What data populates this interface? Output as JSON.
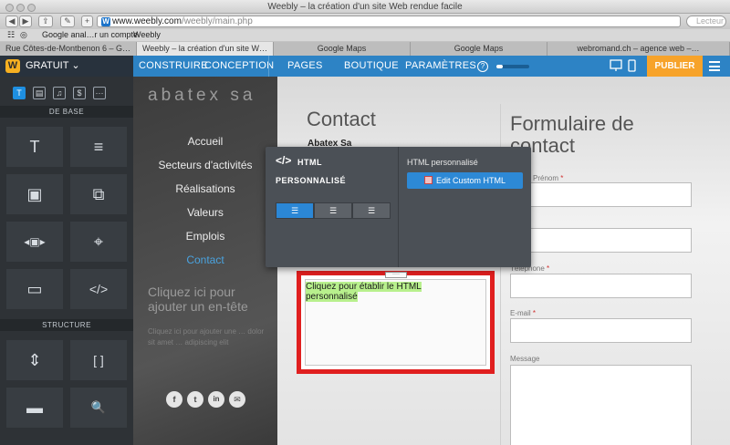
{
  "browser": {
    "window_title": "Weebly – la création d'un site Web rendue facile",
    "url_domain": "www.weebly.com",
    "url_path": "/weebly/main.php",
    "search_placeholder": "Lecteur",
    "bookmarks": [
      "Google anal…r un compte",
      "Weebly"
    ],
    "tabs": [
      {
        "label": "Rue Côtes-de-Montbenon 6 – G…",
        "active": false
      },
      {
        "label": "Weebly – la création d'un site W…",
        "active": true
      },
      {
        "label": "Google Maps",
        "active": false
      },
      {
        "label": "Google Maps",
        "active": false
      },
      {
        "label": "webromand.ch – agence web –…",
        "active": false
      }
    ]
  },
  "editor": {
    "logo": "W",
    "plan": "GRATUIT",
    "nav": [
      "CONSTRUIRE",
      "CONCEPTION",
      "PAGES",
      "BOUTIQUE",
      "PARAMÈTRES"
    ],
    "help": "?",
    "progress_fraction": 0.2,
    "publish": "PUBLIER"
  },
  "sidebar": {
    "categories": [
      "T",
      "▤",
      "♫",
      "$",
      "···"
    ],
    "section_basic": "DE BASE",
    "section_structure": "STRUCTURE",
    "elements": [
      "T",
      "≡",
      "▣",
      "⧉",
      "◂▣▸",
      "⌖",
      "▭",
      "</>",
      "⇕",
      "[ ]",
      "▬",
      "🔍"
    ]
  },
  "site": {
    "logo_text": "abatex sa",
    "menu": [
      "Accueil",
      "Secteurs d'activités",
      "Réalisations",
      "Valeurs",
      "Emplois",
      "Contact"
    ],
    "headline_line1": "Cliquez ici pour",
    "headline_line2": "ajouter un en-tête",
    "subtext": "Cliquez ici pour ajouter une … dolor sit amet … adipiscing elit",
    "social": [
      "f",
      "t",
      "in",
      "✉"
    ]
  },
  "content": {
    "contact_title": "Contact",
    "company": "Abatex Sa",
    "form_title_line1": "Formulaire de",
    "form_title_line2": "contact",
    "fields": [
      {
        "label": "Prénom",
        "required": true
      },
      {
        "label": "",
        "required": false
      },
      {
        "label": "Téléphone",
        "required": true
      },
      {
        "label": "E-mail",
        "required": true
      },
      {
        "label": "Message",
        "required": false
      }
    ],
    "html_placeholder_line1": "Cliquez pour établir le HTML",
    "html_placeholder_line2": "personnalisé"
  },
  "panel": {
    "icon": "</>",
    "title": "HTML PERSONNALISÉ",
    "align_options": [
      "left",
      "center",
      "right"
    ],
    "right_label": "HTML personnalisé",
    "button": "Edit Custom HTML"
  }
}
